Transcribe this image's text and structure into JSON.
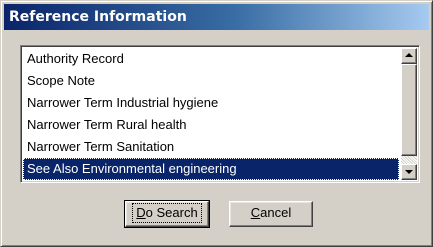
{
  "window": {
    "title": "Reference Information"
  },
  "list": {
    "items": [
      {
        "label": "Authority Record"
      },
      {
        "label": "Scope Note"
      },
      {
        "label": "Narrower Term Industrial hygiene"
      },
      {
        "label": "Narrower Term Rural health"
      },
      {
        "label": "Narrower Term Sanitation"
      },
      {
        "label": "See Also Environmental engineering",
        "selected": true
      }
    ],
    "scroll_up_icon": "triangle-up-icon",
    "scroll_down_icon": "triangle-down-icon"
  },
  "buttons": {
    "search": {
      "mnemonic": "D",
      "rest": "o Search"
    },
    "cancel": {
      "mnemonic": "C",
      "rest": "ancel"
    }
  },
  "colors": {
    "title_gradient_start": "#0a246a",
    "title_gradient_end": "#a6caf0",
    "selection": "#0a246a",
    "dialog_face": "#d4d0c8"
  }
}
